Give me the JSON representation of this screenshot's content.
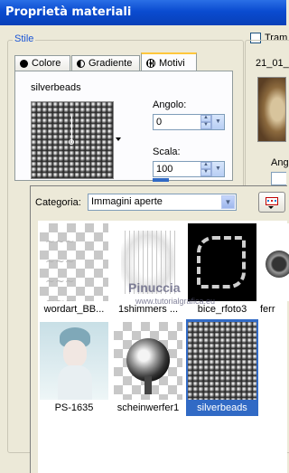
{
  "window": {
    "title": "Proprietà materiali"
  },
  "style_group": {
    "label": "Stile"
  },
  "tabs": [
    {
      "label": "Colore",
      "icon": "solid-circle-icon"
    },
    {
      "label": "Gradiente",
      "icon": "half-circle-icon"
    },
    {
      "label": "Motivi",
      "icon": "pattern-globe-icon",
      "active": true
    }
  ],
  "pattern": {
    "name": "silverbeads"
  },
  "angle": {
    "label": "Angolo:",
    "value": "0"
  },
  "scale": {
    "label": "Scala:",
    "value": "100"
  },
  "right_panel": {
    "checkbox_label": "Tram",
    "file_label": "21_01_",
    "partial_label": "Ang"
  },
  "popup": {
    "category_label": "Categoria:",
    "category_value": "Immagini aperte",
    "watermark": "Pinuccia",
    "watermark_url": "www.tutorialgrafica.eu",
    "items": [
      {
        "caption": "wordart_BB..."
      },
      {
        "caption": "1shimmers ..."
      },
      {
        "caption": "bice_rfoto3"
      },
      {
        "caption": "ferr"
      },
      {
        "caption": "PS-1635"
      },
      {
        "caption": "scheinwerfer1"
      },
      {
        "caption": "silverbeads",
        "selected": true
      }
    ]
  }
}
